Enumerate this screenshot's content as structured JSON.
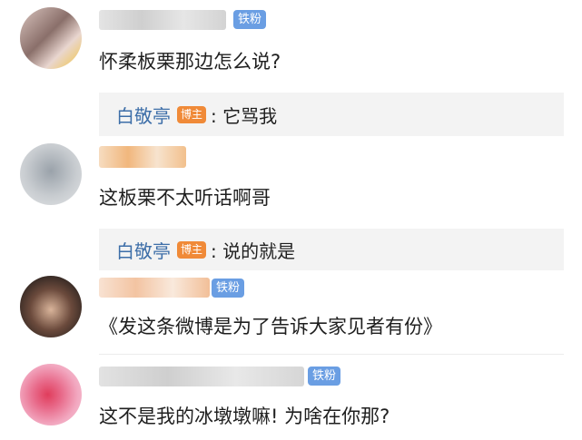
{
  "comments": [
    {
      "badge": "铁粉",
      "text": "怀柔板栗那边怎么说?",
      "reply": {
        "name": "白敬亭",
        "tag": "博主",
        "text": ": 它骂我"
      }
    },
    {
      "badge": "",
      "text": "这板栗不太听话啊哥",
      "reply": {
        "name": "白敬亭",
        "tag": "博主",
        "text": ": 说的就是"
      }
    },
    {
      "badge": "铁粉",
      "text": "《发这条微博是为了告诉大家见者有份》",
      "reply": null
    },
    {
      "badge": "铁粉",
      "text": "这不是我的冰墩墩嘛! 为啥在你那?",
      "reply": null
    }
  ],
  "colors": {
    "badge": "#6a9ee3",
    "tag": "#f08a38",
    "reply_name": "#3d6ea8",
    "reply_bg": "#f3f3f3"
  }
}
